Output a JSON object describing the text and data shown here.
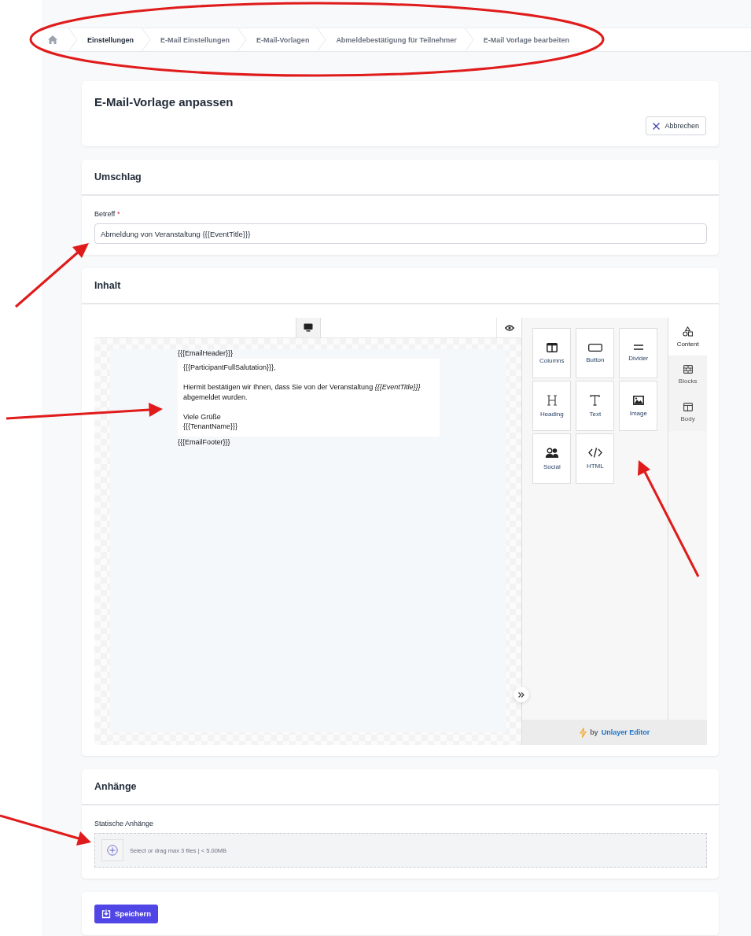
{
  "breadcrumb": [
    {
      "label": "Einstellungen",
      "bold": true
    },
    {
      "label": "E-Mail Einstellungen",
      "bold": false
    },
    {
      "label": "E-Mail-Vorlagen",
      "bold": false
    },
    {
      "label": "Abmeldebestätigung für Teilnehmer",
      "bold": false
    },
    {
      "label": "E-Mail Vorlage bearbeiten",
      "bold": false
    }
  ],
  "page_title": "E-Mail-Vorlage anpassen",
  "cancel_button": "Abbrechen",
  "envelope": {
    "title": "Umschlag",
    "subject_label": "Betreff",
    "required_mark": "*",
    "subject_value": "Abmeldung von Veranstaltung {{{EventTitle}}}"
  },
  "content": {
    "title": "Inhalt",
    "device_buttons": [
      {
        "kind": "desktop",
        "selected": true
      },
      {
        "kind": "preview",
        "selected": false
      }
    ],
    "email": {
      "header": "{{{EmailHeader}}}",
      "paragraphs": [
        [
          "{{{ParticipantFullSalutation}}},"
        ],
        [
          "Hiermit bestätigen wir Ihnen, dass Sie von der Veranstaltung *{{{EventTitle}}}* abgemeldet wurden."
        ],
        [
          "Viele Grüße",
          "{{{TenantName}}}"
        ]
      ],
      "footer": "{{{EmailFooter}}}"
    },
    "tools": [
      {
        "kind": "columns",
        "label": "Columns"
      },
      {
        "kind": "button",
        "label": "Button"
      },
      {
        "kind": "divider",
        "label": "Divider"
      },
      {
        "kind": "heading",
        "label": "Heading"
      },
      {
        "kind": "text",
        "label": "Text"
      },
      {
        "kind": "image",
        "label": "Image"
      },
      {
        "kind": "social",
        "label": "Social"
      },
      {
        "kind": "html",
        "label": "HTML"
      }
    ],
    "tabs": [
      {
        "kind": "content",
        "label": "Content",
        "selected": true
      },
      {
        "kind": "blocks",
        "label": "Blocks",
        "selected": false
      },
      {
        "kind": "body",
        "label": "Body",
        "selected": false
      }
    ],
    "footer_by": "by",
    "footer_brand": "Unlayer Editor"
  },
  "attachments": {
    "title": "Anhänge",
    "label": "Statische Anhänge",
    "dropzone_text": "Select or drag max 3 files | < 5.00MB"
  },
  "save_button": "Speichern"
}
